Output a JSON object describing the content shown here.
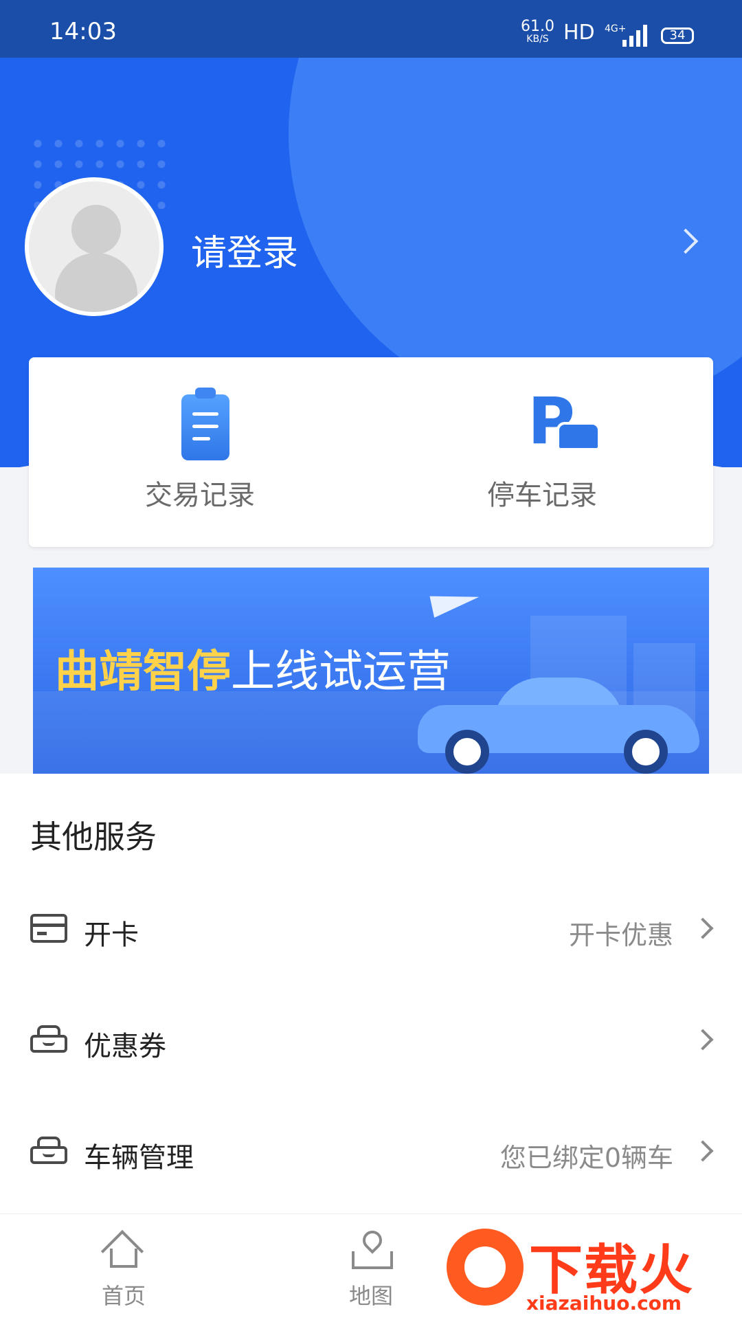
{
  "status_bar": {
    "time": "14:03",
    "net_speed": "61.0",
    "net_unit": "KB/S",
    "hd": "HD",
    "signal": "4G+",
    "battery": "34"
  },
  "profile": {
    "login_text": "请登录"
  },
  "records": {
    "transactions": "交易记录",
    "parking": "停车记录"
  },
  "banner": {
    "title_highlight": "曲靖智停",
    "title_rest": "上线试运营"
  },
  "services": {
    "title": "其他服务",
    "items": [
      {
        "label": "开卡",
        "value": "开卡优惠",
        "icon": "card-icon"
      },
      {
        "label": "优惠券",
        "value": "",
        "icon": "coupon-car-icon"
      },
      {
        "label": "车辆管理",
        "value": "您已绑定0辆车",
        "icon": "vehicle-car-icon"
      }
    ]
  },
  "tabbar": {
    "home": "首页",
    "map": "地图"
  },
  "watermark": {
    "text": "下载火",
    "url": "xiazaihuo.com"
  },
  "colors": {
    "primary": "#1f63ef",
    "statusbar": "#1a4ea8",
    "watermark": "#ff3b19"
  }
}
